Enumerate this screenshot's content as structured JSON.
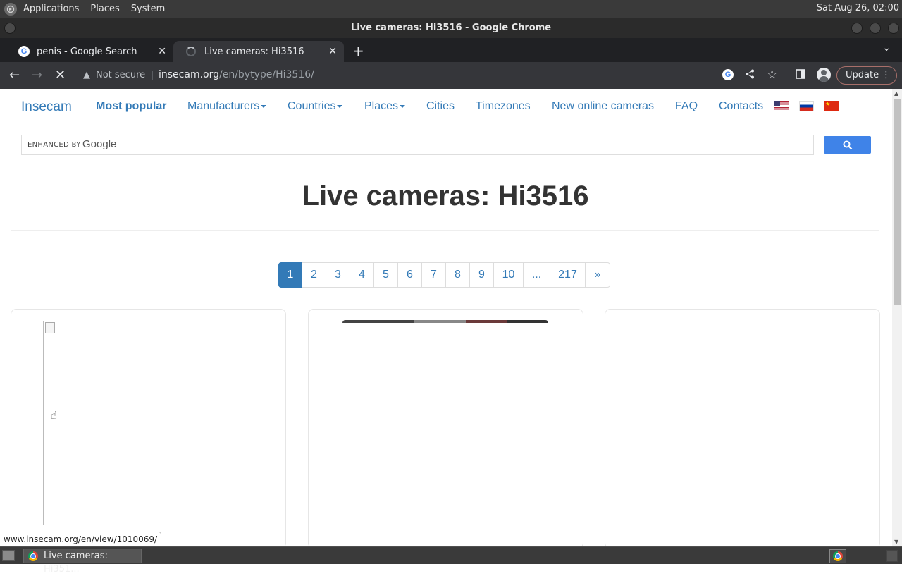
{
  "panel": {
    "menus": [
      "Applications",
      "Places",
      "System"
    ],
    "clock": "Sat Aug 26, 02:00"
  },
  "window": {
    "title": "Live cameras: Hi3516 - Google Chrome"
  },
  "tabs": [
    {
      "label": "penis - Google Search",
      "state": "inactive"
    },
    {
      "label": "Live cameras: Hi3516",
      "state": "active-loading"
    }
  ],
  "toolbar": {
    "security_label": "Not secure",
    "url_host": "insecam.org",
    "url_path": "/en/bytype/Hi3516/",
    "update_label": "Update"
  },
  "site": {
    "brand": "Insecam",
    "nav": [
      {
        "label": "Most popular",
        "dropdown": false
      },
      {
        "label": "Manufacturers",
        "dropdown": true
      },
      {
        "label": "Countries",
        "dropdown": true
      },
      {
        "label": "Places",
        "dropdown": true
      },
      {
        "label": "Cities",
        "dropdown": false
      },
      {
        "label": "Timezones",
        "dropdown": false
      },
      {
        "label": "New online cameras",
        "dropdown": false
      },
      {
        "label": "FAQ",
        "dropdown": false
      },
      {
        "label": "Contacts",
        "dropdown": false
      }
    ],
    "flags": [
      "us-flag",
      "ru-flag",
      "cn-flag"
    ],
    "search": {
      "enhanced_label": "ENHANCED BY",
      "google_label": "Google"
    },
    "page_title": "Live cameras: Hi3516",
    "pagination": [
      "1",
      "2",
      "3",
      "4",
      "5",
      "6",
      "7",
      "8",
      "9",
      "10",
      "...",
      "217",
      "»"
    ],
    "pagination_active": "1"
  },
  "status_url": "www.insecam.org/en/view/1010069/",
  "taskbar": {
    "task_label": "Live cameras: Hi351..."
  },
  "colors": {
    "link": "#337ab7",
    "search_button": "#3f83e8",
    "chrome_dark": "#35363a"
  }
}
